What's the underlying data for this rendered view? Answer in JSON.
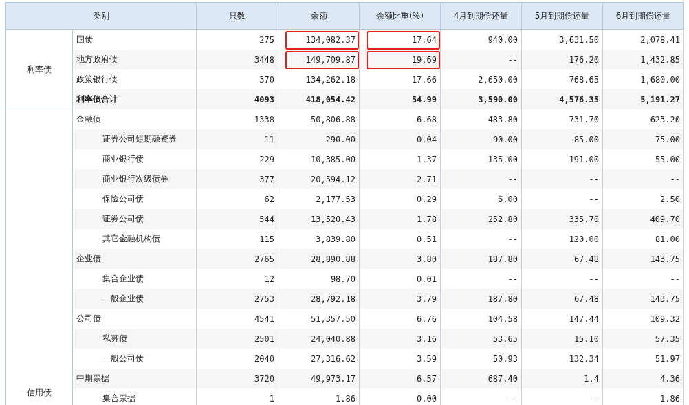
{
  "table": {
    "category_header": "类别",
    "columns": [
      "只数",
      "余额",
      "余额比重(%)",
      "4月到期偿还量",
      "5月到期偿还量",
      "6月到期偿还量"
    ],
    "groups": [
      {
        "label": "利率债",
        "rows": [
          {
            "name": "国债",
            "kind": "item",
            "cells": [
              "275",
              "134,082.37",
              "17.64",
              "940.00",
              "3,631.50",
              "2,078.41"
            ],
            "boxed": [
              false,
              true,
              true,
              false,
              false,
              false
            ]
          },
          {
            "name": "地方政府债",
            "kind": "item",
            "cells": [
              "3448",
              "149,709.87",
              "19.69",
              "--",
              "176.20",
              "1,432.85"
            ],
            "boxed": [
              false,
              true,
              true,
              false,
              false,
              false
            ]
          },
          {
            "name": "政策银行债",
            "kind": "item",
            "cells": [
              "370",
              "134,262.18",
              "17.66",
              "2,650.00",
              "768.65",
              "1,680.00"
            ],
            "boxed": [
              false,
              false,
              false,
              false,
              false,
              false
            ]
          },
          {
            "name": "利率债合计",
            "kind": "total",
            "cells": [
              "4093",
              "418,054.42",
              "54.99",
              "3,590.00",
              "4,576.35",
              "5,191.27"
            ],
            "boxed": [
              false,
              false,
              false,
              false,
              false,
              false
            ]
          }
        ]
      },
      {
        "label": "信用债",
        "rows": [
          {
            "name": "金融债",
            "kind": "item",
            "cells": [
              "1338",
              "50,806.88",
              "6.68",
              "483.80",
              "731.70",
              "623.20"
            ],
            "boxed": [
              false,
              false,
              false,
              false,
              false,
              false
            ],
            "children": [
              {
                "name": "证券公司短期融资券",
                "kind": "item",
                "cells": [
                  "11",
                  "290.00",
                  "0.04",
                  "90.00",
                  "85.00",
                  "75.00"
                ],
                "boxed": [
                  false,
                  false,
                  false,
                  false,
                  false,
                  false
                ]
              },
              {
                "name": "商业银行债",
                "kind": "item",
                "cells": [
                  "229",
                  "10,385.00",
                  "1.37",
                  "135.00",
                  "191.00",
                  "55.00"
                ],
                "boxed": [
                  false,
                  false,
                  false,
                  false,
                  false,
                  false
                ]
              },
              {
                "name": "商业银行次级债券",
                "kind": "item",
                "cells": [
                  "377",
                  "20,594.12",
                  "2.71",
                  "--",
                  "--",
                  "--"
                ],
                "boxed": [
                  false,
                  false,
                  false,
                  false,
                  false,
                  false
                ]
              },
              {
                "name": "保险公司债",
                "kind": "item",
                "cells": [
                  "62",
                  "2,177.53",
                  "0.29",
                  "6.00",
                  "--",
                  "2.50"
                ],
                "boxed": [
                  false,
                  false,
                  false,
                  false,
                  false,
                  false
                ]
              },
              {
                "name": "证券公司债",
                "kind": "item",
                "cells": [
                  "544",
                  "13,520.43",
                  "1.78",
                  "252.80",
                  "335.70",
                  "409.70"
                ],
                "boxed": [
                  false,
                  false,
                  false,
                  false,
                  false,
                  false
                ]
              },
              {
                "name": "其它金融机构债",
                "kind": "item",
                "cells": [
                  "115",
                  "3,839.80",
                  "0.51",
                  "--",
                  "120.00",
                  "81.00"
                ],
                "boxed": [
                  false,
                  false,
                  false,
                  false,
                  false,
                  false
                ]
              }
            ]
          },
          {
            "name": "企业债",
            "kind": "item",
            "cells": [
              "2765",
              "28,890.88",
              "3.80",
              "187.80",
              "67.48",
              "143.75"
            ],
            "boxed": [
              false,
              false,
              false,
              false,
              false,
              false
            ],
            "children": [
              {
                "name": "集合企业债",
                "kind": "item",
                "cells": [
                  "12",
                  "98.70",
                  "0.01",
                  "--",
                  "--",
                  "--"
                ],
                "boxed": [
                  false,
                  false,
                  false,
                  false,
                  false,
                  false
                ]
              },
              {
                "name": "一般企业债",
                "kind": "item",
                "cells": [
                  "2753",
                  "28,792.18",
                  "3.79",
                  "187.80",
                  "67.48",
                  "143.75"
                ],
                "boxed": [
                  false,
                  false,
                  false,
                  false,
                  false,
                  false
                ]
              }
            ]
          },
          {
            "name": "公司债",
            "kind": "item",
            "cells": [
              "4541",
              "51,357.50",
              "6.76",
              "104.58",
              "147.44",
              "109.32"
            ],
            "boxed": [
              false,
              false,
              false,
              false,
              false,
              false
            ],
            "children": [
              {
                "name": "私募债",
                "kind": "item",
                "cells": [
                  "2501",
                  "24,040.88",
                  "3.16",
                  "53.65",
                  "15.10",
                  "57.35"
                ],
                "boxed": [
                  false,
                  false,
                  false,
                  false,
                  false,
                  false
                ]
              },
              {
                "name": "一般公司债",
                "kind": "item",
                "cells": [
                  "2040",
                  "27,316.62",
                  "3.59",
                  "50.93",
                  "132.34",
                  "51.97"
                ],
                "boxed": [
                  false,
                  false,
                  false,
                  false,
                  false,
                  false
                ]
              }
            ]
          },
          {
            "name": "中期票据",
            "kind": "item",
            "cells": [
              "3720",
              "49,973.17",
              "6.57",
              "687.40",
              "1,4",
              "4.36"
            ],
            "boxed": [
              false,
              false,
              false,
              false,
              false,
              false
            ],
            "children": [
              {
                "name": "集合票据",
                "kind": "item",
                "cells": [
                  "1",
                  "1.86",
                  "0.00",
                  "--",
                  "--",
                  "1.86"
                ],
                "boxed": [
                  false,
                  false,
                  false,
                  false,
                  false,
                  false
                ]
              }
            ]
          }
        ]
      }
    ]
  }
}
